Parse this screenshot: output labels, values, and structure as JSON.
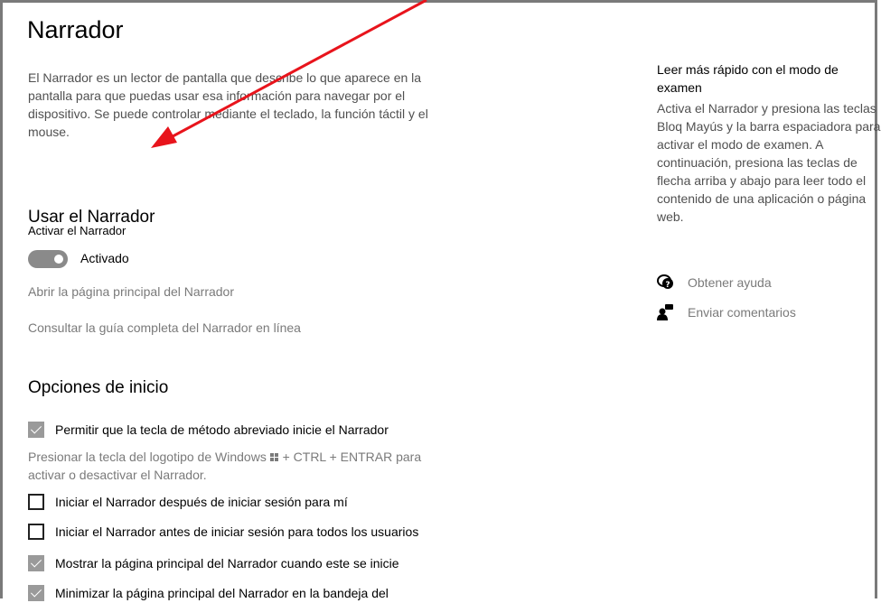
{
  "page": {
    "title": "Narrador",
    "description": "El Narrador es un lector de pantalla que describe lo que aparece en la pantalla para que puedas usar esa información para navegar por el dispositivo. Se puede controlar mediante el teclado, la función táctil y el mouse."
  },
  "use_section": {
    "heading": "Usar el Narrador",
    "toggle_label": "Activar el Narrador",
    "toggle_state": "Activado",
    "link_home": "Abrir la página principal del Narrador",
    "link_guide": "Consultar la guía completa del Narrador en línea"
  },
  "start_section": {
    "heading": "Opciones de inicio",
    "options": [
      {
        "label": "Permitir que la tecla de método abreviado inicie el Narrador",
        "checked": true
      },
      {
        "label": "Iniciar el Narrador después de iniciar sesión para mí",
        "checked": false
      },
      {
        "label": "Iniciar el Narrador antes de iniciar sesión para todos los usuarios",
        "checked": false
      },
      {
        "label": "Mostrar la página principal del Narrador cuando este se inicie",
        "checked": true
      },
      {
        "label": "Minimizar la página principal del Narrador en la bandeja del",
        "checked": true
      }
    ],
    "hint_part1": "Presionar la tecla del logotipo de Windows",
    "hint_part2": "+ CTRL + ENTRAR para activar o desactivar el Narrador."
  },
  "sidebar": {
    "title": "Leer más rápido con el modo de examen",
    "description": "Activa el Narrador y presiona las teclas Bloq Mayús y la barra espaciadora para activar el modo de examen. A continuación, presiona las teclas de flecha arriba y abajo para leer todo el contenido de una aplicación o página web.",
    "help_link": "Obtener ayuda",
    "feedback_link": "Enviar comentarios",
    "help_icon": "help-chat-icon",
    "feedback_icon": "feedback-person-icon"
  },
  "annotation": {
    "arrow_color": "#e8141c"
  },
  "colors": {
    "toggle_on": "#8a8a8a",
    "checkbox_checked": "#9a9a9a",
    "link": "#7a7a7a"
  }
}
